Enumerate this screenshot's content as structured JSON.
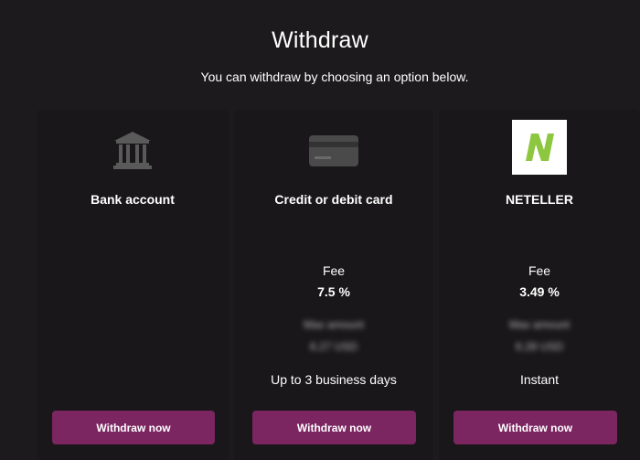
{
  "page": {
    "title": "Withdraw",
    "subtitle": "You can withdraw by choosing an option below."
  },
  "colors": {
    "background": "#1c1a1c",
    "button": "#7b2561",
    "neteller_green": "#8dc63f"
  },
  "options": [
    {
      "icon": "bank-icon",
      "name": "Bank account",
      "fee_label": "",
      "fee_value": "",
      "max_amount_label": "",
      "max_amount_value": "",
      "timing": "",
      "button": "Withdraw now"
    },
    {
      "icon": "credit-card-icon",
      "name": "Credit or debit card",
      "fee_label": "Fee",
      "fee_value": "7.5 %",
      "max_amount_label": "Max amount",
      "max_amount_value": "6.27 USD",
      "timing": "Up to 3 business days",
      "button": "Withdraw now"
    },
    {
      "icon": "neteller-logo",
      "name": "NETELLER",
      "fee_label": "Fee",
      "fee_value": "3.49 %",
      "max_amount_label": "Max amount",
      "max_amount_value": "6.28 USD",
      "timing": "Instant",
      "button": "Withdraw now"
    }
  ]
}
